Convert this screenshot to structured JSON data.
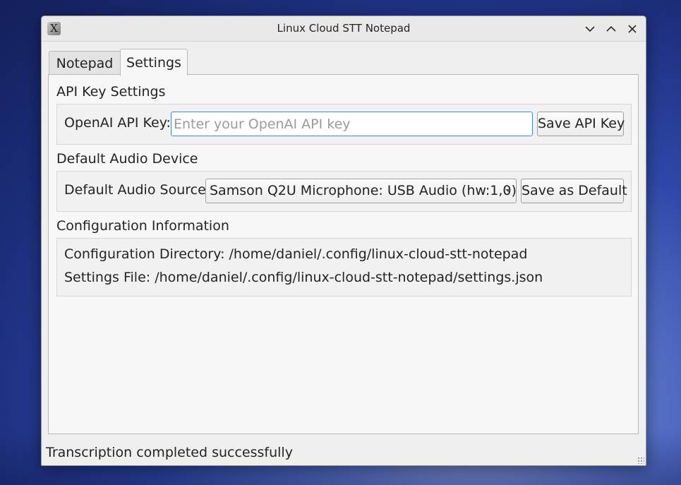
{
  "window": {
    "title": "Linux Cloud STT Notepad",
    "app_icon_glyph": "X",
    "controls": [
      "chevron-down-icon",
      "chevron-up-icon",
      "close-icon"
    ]
  },
  "tabs": [
    {
      "label": "Notepad",
      "active": false
    },
    {
      "label": "Settings",
      "active": true
    }
  ],
  "settings": {
    "api_section": {
      "title": "API Key Settings",
      "field_label": "OpenAI API Key:",
      "field_value": "",
      "field_placeholder": "Enter your OpenAI API key",
      "save_button": "Save API Key"
    },
    "audio_section": {
      "title": "Default Audio Device",
      "field_label": "Default Audio Source:",
      "selected_source": "Samson Q2U Microphone: USB Audio (hw:1,0)",
      "save_button": "Save as Default"
    },
    "config_section": {
      "title": "Configuration Information",
      "directory_line": "Configuration Directory: /home/daniel/.config/linux-cloud-stt-notepad",
      "settings_file_line": "Settings File: /home/daniel/.config/linux-cloud-stt-notepad/settings.json"
    }
  },
  "status": {
    "message": "Transcription completed successfully"
  },
  "colors": {
    "focus_border": "#3b8fd6",
    "window_bg": "#efefef",
    "pane_bg": "#f7f7f7"
  }
}
